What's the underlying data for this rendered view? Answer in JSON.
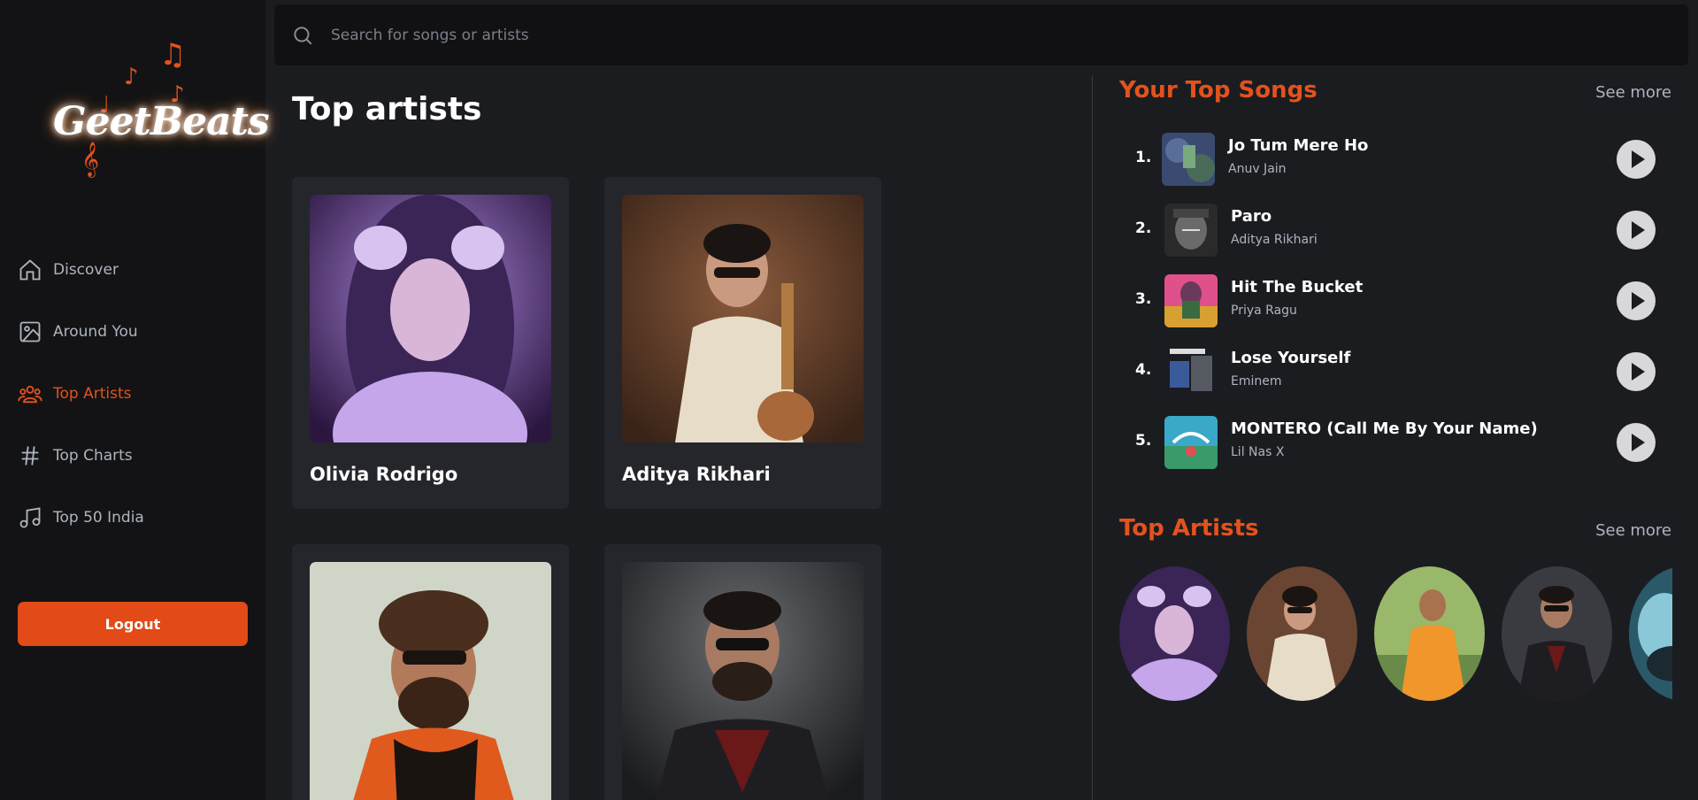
{
  "sidebar": {
    "logo_text": "GeetBeats",
    "nav": [
      {
        "label": "Discover",
        "icon": "home-icon"
      },
      {
        "label": "Around You",
        "icon": "image-icon"
      },
      {
        "label": "Top Artists",
        "icon": "users-icon",
        "active": true
      },
      {
        "label": "Top Charts",
        "icon": "hash-icon"
      },
      {
        "label": "Top 50 India",
        "icon": "music-note-icon"
      }
    ],
    "logout_label": "Logout"
  },
  "search": {
    "placeholder": "Search for songs or artists"
  },
  "main": {
    "title": "Top artists",
    "artists": [
      {
        "name": "Olivia Rodrigo"
      },
      {
        "name": "Aditya Rikhari"
      },
      {
        "name": ""
      },
      {
        "name": ""
      }
    ]
  },
  "right": {
    "top_songs_title": "Your Top Songs",
    "see_more": "See more",
    "songs": [
      {
        "num": "1.",
        "title": "Jo Tum Mere Ho",
        "artist": "Anuv Jain"
      },
      {
        "num": "2.",
        "title": "Paro",
        "artist": "Aditya Rikhari"
      },
      {
        "num": "3.",
        "title": "Hit The Bucket",
        "artist": "Priya Ragu"
      },
      {
        "num": "4.",
        "title": "Lose Yourself",
        "artist": "Eminem"
      },
      {
        "num": "5.",
        "title": "MONTERO (Call Me By Your Name)",
        "artist": "Lil Nas X"
      }
    ],
    "top_artists_title": "Top Artists",
    "see_more_2": "See more"
  },
  "colors": {
    "accent": "#e4521c",
    "bg": "#1b1c20",
    "sidebar": "#131315",
    "card": "#25262b"
  }
}
